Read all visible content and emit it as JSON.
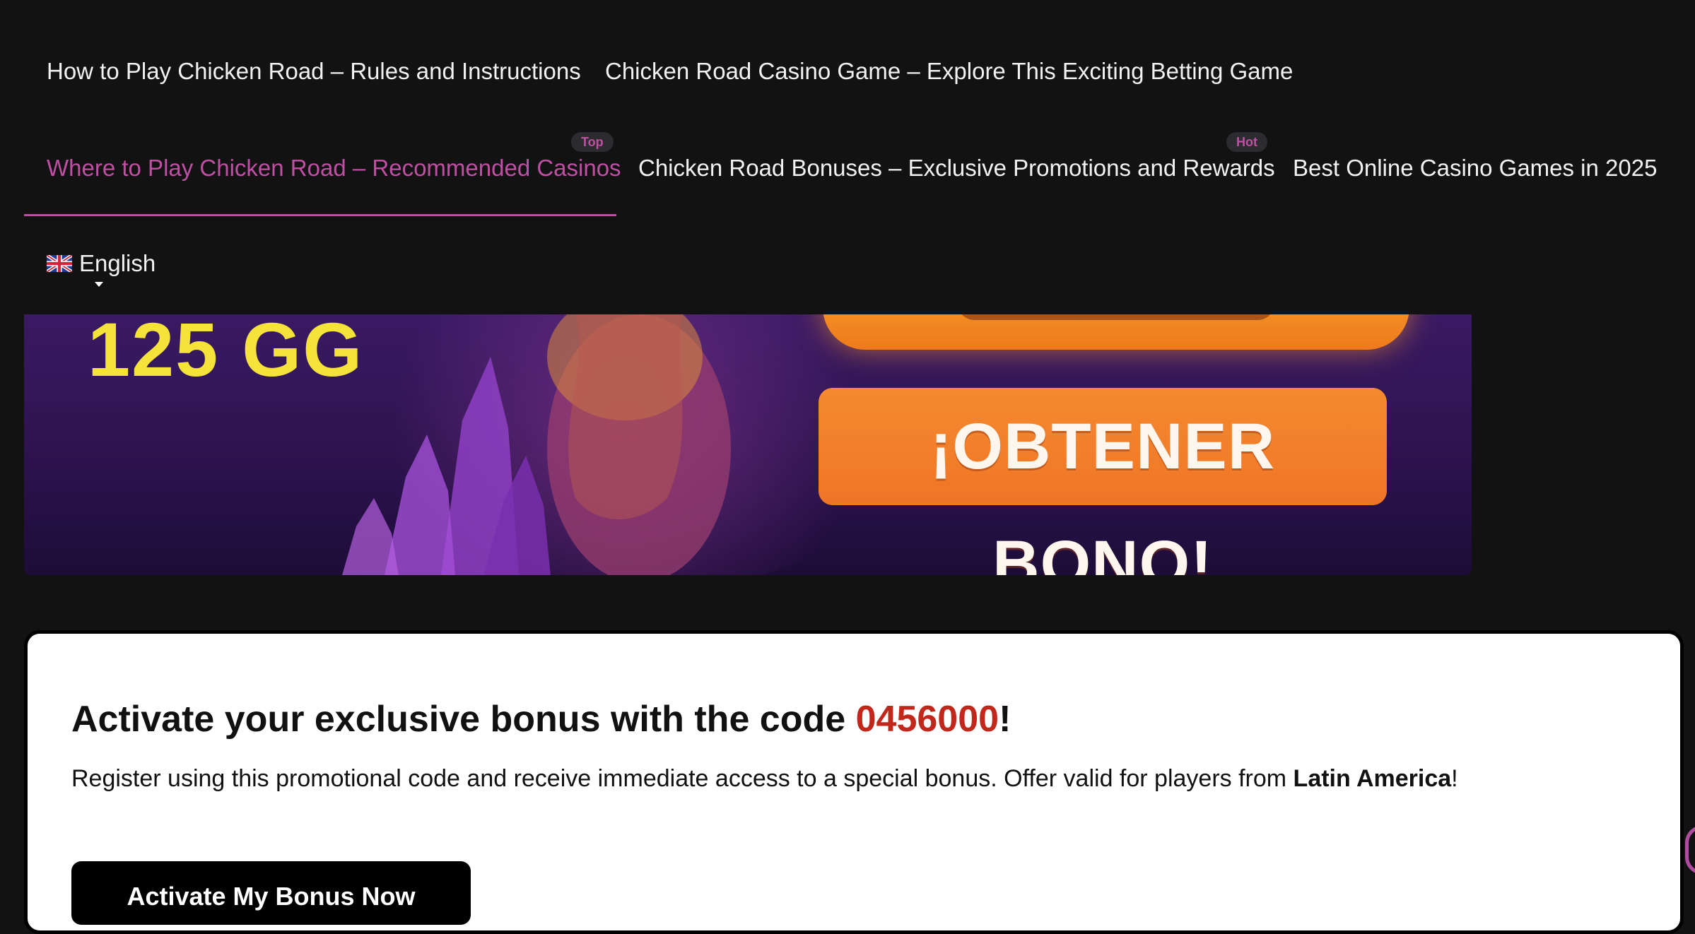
{
  "nav": {
    "items": [
      {
        "label": "How to Play Chicken Road – Rules and Instructions"
      },
      {
        "label": "Chicken Road Casino Game – Explore This Exciting Betting Game"
      },
      {
        "label": "Where to Play Chicken Road – Recommended Casinos",
        "badge": "Top",
        "active": true
      },
      {
        "label": "Chicken Road Bonuses – Exclusive Promotions and Rewards",
        "badge": "Hot"
      },
      {
        "label": "Best Online Casino Games in 2025"
      }
    ],
    "language": {
      "label": "English",
      "flag": "uk-flag-icon"
    }
  },
  "banner": {
    "amount_text": "125 GG",
    "cta_label": "¡OBTENER BONO!"
  },
  "promo_card": {
    "title_prefix": "Activate your exclusive bonus with the code ",
    "code": "0456000",
    "title_suffix": "!",
    "text_prefix": "Register using this promotional code and receive immediate access to a special bonus. Offer valid for players from ",
    "text_bold": "Latin America",
    "text_suffix": "!",
    "button_label": "Activate My Bonus Now"
  },
  "colors": {
    "background": "#121213",
    "accent": "#c04fa4",
    "code": "#c1271b",
    "banner_button": "#ef7526",
    "banner_text": "#f6e33a"
  }
}
